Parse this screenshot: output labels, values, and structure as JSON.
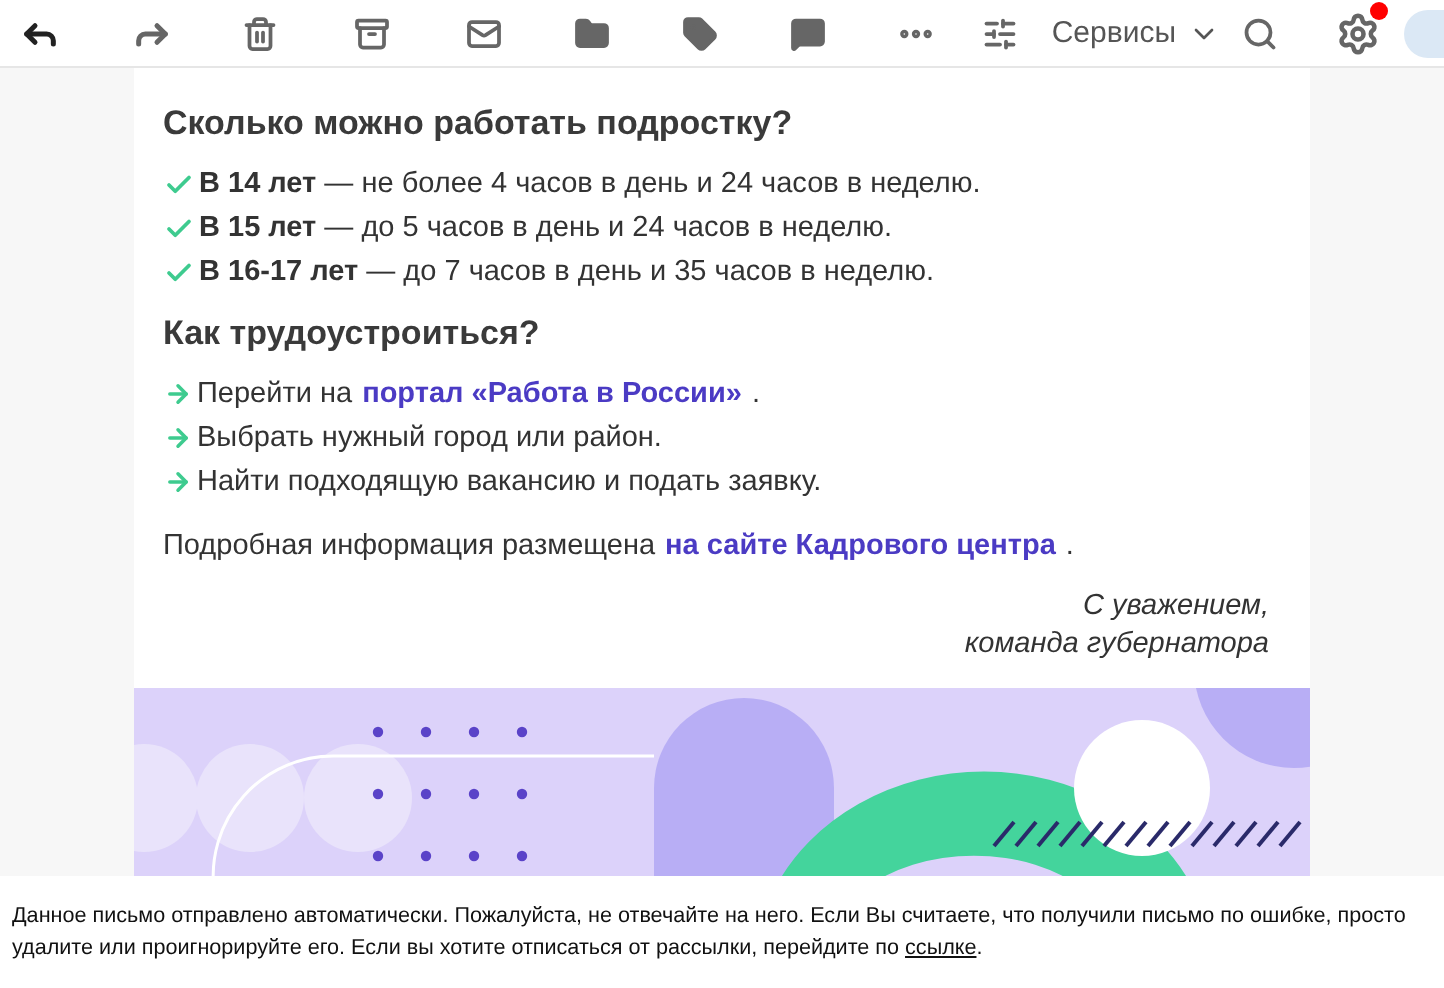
{
  "toolbar": {
    "services_label": "Сервисы",
    "notification_dot": true
  },
  "sections": [
    {
      "title": "Сколько можно работать подростку?",
      "kind": "check",
      "items": [
        {
          "parts": [
            {
              "text": "**В 14 лет** — не более 4 часов в день и 24 часов в неделю.",
              "link": false
            }
          ]
        },
        {
          "parts": [
            {
              "text": "**В 15 лет** — до 5 часов в день и 24 часов в неделю.",
              "link": false
            }
          ]
        },
        {
          "parts": [
            {
              "text": "**В 16-17 лет** — до 7 часов в день и 35 часов в неделю.",
              "link": false
            }
          ]
        }
      ]
    },
    {
      "title": "Как трудоустроиться?",
      "kind": "arrow",
      "items": [
        {
          "parts": [
            {
              "text": "Перейти на",
              "link": false
            },
            {
              "text": "портал «Работа в России»",
              "link": true
            },
            {
              "text": ".",
              "link": false
            }
          ]
        },
        {
          "parts": [
            {
              "text": "Выбрать нужный город или район.",
              "link": false
            }
          ]
        },
        {
          "parts": [
            {
              "text": "Найти подходящую вакансию и подать заявку.",
              "link": false
            }
          ]
        }
      ]
    }
  ],
  "info": [
    {
      "text": "Подробная информация размещена",
      "link": false
    },
    {
      "text": "на сайте Кадрового центра",
      "link": true
    },
    {
      "text": ".",
      "link": false
    }
  ],
  "signature": [
    "С уважением,",
    "команда губернатора"
  ],
  "footer": {
    "lines": [
      [
        {
          "text": "Данное письмо отправлено автоматически. Пожалуйста, не отвечайте на него. Если Вы считаете, что получили письмо по ошибке, просто",
          "link": false
        }
      ],
      [
        {
          "text": "удалите или проигнорируйте его. Если вы хотите отписаться от рассылки, перейдите по",
          "link": false
        },
        {
          "text": "ссылке",
          "link": true
        },
        {
          "text": ".",
          "link": false
        }
      ]
    ]
  }
}
